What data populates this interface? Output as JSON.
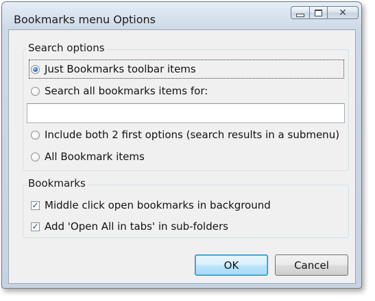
{
  "window": {
    "title": "Bookmarks menu Options"
  },
  "search_options": {
    "legend": "Search options",
    "options": [
      {
        "label": "Just Bookmarks toolbar items",
        "selected": true
      },
      {
        "label": "Search all bookmarks items for:",
        "selected": false
      },
      {
        "label": "Include both 2 first options (search results in a submenu)",
        "selected": false
      },
      {
        "label": "All Bookmark items",
        "selected": false
      }
    ],
    "search_field_value": ""
  },
  "bookmarks": {
    "legend": "Bookmarks",
    "checkboxes": [
      {
        "label": "Middle click open bookmarks in background",
        "checked": true
      },
      {
        "label": "Add 'Open All in tabs' in sub-folders",
        "checked": true
      }
    ]
  },
  "buttons": {
    "ok_label": "OK",
    "cancel_label": "Cancel"
  },
  "icons": {
    "minimize": "minimize-icon",
    "maximize": "maximize-icon",
    "close": "close-icon",
    "checkmark": "✓"
  },
  "colors": {
    "default_button_border": "#3c7fb1",
    "radio_selected": "#1e5fb0",
    "checkmark": "#1e4f8f"
  }
}
